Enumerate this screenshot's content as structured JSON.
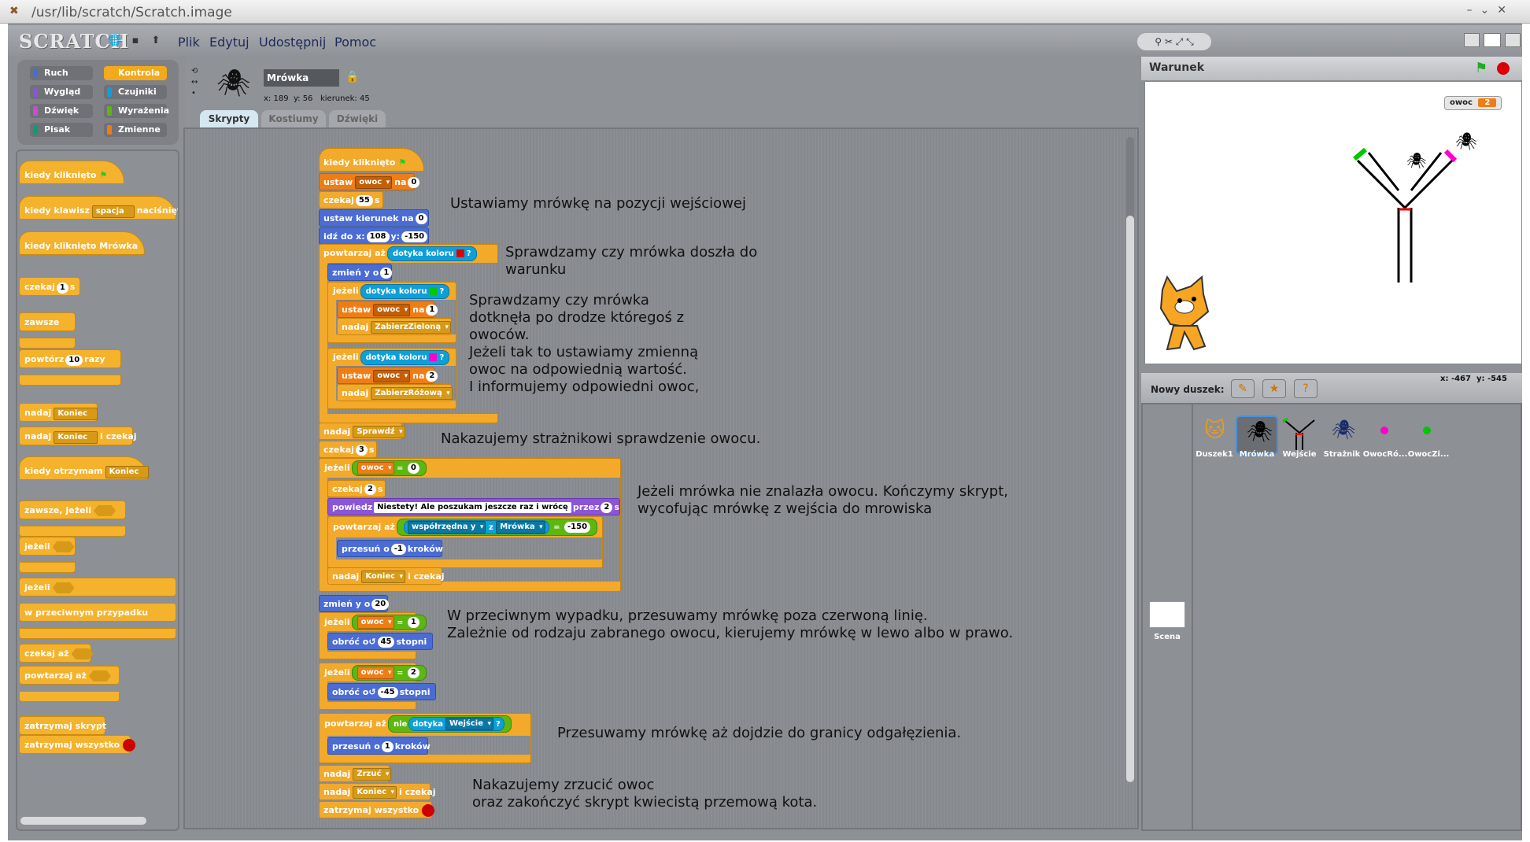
{
  "window": {
    "title": "/usr/lib/scratch/Scratch.image"
  },
  "menu": {
    "logo": "SCRATCH",
    "file": "Plik",
    "edit": "Edytuj",
    "share": "Udostępnij",
    "help": "Pomoc"
  },
  "categories": {
    "motion": "Ruch",
    "control": "Kontrola",
    "looks": "Wygląd",
    "sensing": "Czujniki",
    "sound": "Dźwięk",
    "operators": "Wyrażenia",
    "pen": "Pisak",
    "variables": "Zmienne"
  },
  "palette": {
    "when_flag": "kiedy kliknięto",
    "when_key": "kiedy klawisz",
    "key_value": "spacja",
    "key_pressed": "naciśnięty",
    "when_clicked": "kiedy kliknięto Mrówka",
    "wait": "czekaj",
    "wait_n": "1",
    "wait_unit": "s",
    "forever": "zawsze",
    "repeat": "powtórz",
    "repeat_n": "10",
    "repeat_unit": "razy",
    "broadcast": "nadaj",
    "broadcast_msg": "Koniec",
    "broadcast_wait": "i czekaj",
    "when_receive": "kiedy otrzymam",
    "forever_if": "zawsze, jeżeli",
    "if": "jeżeli",
    "else": "w przeciwnym przypadku",
    "wait_until": "czekaj aż",
    "repeat_until": "powtarzaj aż",
    "stop_script": "zatrzymaj skrypt",
    "stop_all": "zatrzymaj wszystko"
  },
  "sprite": {
    "name": "Mrówka",
    "x_label": "x:",
    "x": "189",
    "y_label": "y:",
    "y": "56",
    "dir_label": "kierunek:",
    "dir": "45"
  },
  "tabs": {
    "scripts": "Skrypty",
    "costumes": "Kostiumy",
    "sounds": "Dźwięki"
  },
  "script": {
    "b1": "kiedy kliknięto",
    "b2a": "ustaw",
    "b2v": "owoc",
    "b2b": "na",
    "b2n": "0",
    "b3a": "czekaj",
    "b3n": "55",
    "b3b": "s",
    "b4a": "ustaw kierunek na",
    "b4n": "0",
    "b5a": "idź do x:",
    "b5x": "108",
    "b5b": "y:",
    "b5y": "-150",
    "b6a": "powtarzaj aż",
    "b6s": "dotyka koloru",
    "b6q": "?",
    "b7a": "zmień y o",
    "b7n": "1",
    "b8a": "jeżeli",
    "b8s": "dotyka koloru",
    "b8q": "?",
    "b9a": "ustaw",
    "b9v": "owoc",
    "b9b": "na",
    "b9n": "1",
    "b10a": "nadaj",
    "b10m": "ZabierzZieloną",
    "b11a": "jeżeli",
    "b11s": "dotyka koloru",
    "b11q": "?",
    "b12a": "ustaw",
    "b12v": "owoc",
    "b12b": "na",
    "b12n": "2",
    "b13a": "nadaj",
    "b13m": "ZabierzRóżową",
    "b14a": "nadaj",
    "b14m": "Sprawdź",
    "b15a": "czekaj",
    "b15n": "3",
    "b15b": "s",
    "b16a": "jeżeli",
    "b16v": "owoc",
    "b16eq": "=",
    "b16n": "0",
    "b17a": "czekaj",
    "b17n": "2",
    "b17b": "s",
    "b18a": "powiedz",
    "b18t": "Niestety! Ale poszukam jeszcze raz i wrócę",
    "b18b": "przez",
    "b18n": "2",
    "b18c": "s",
    "b19a": "powtarzaj aż",
    "b19s": "współrzędna y",
    "b19z": "z",
    "b19sp": "Mrówka",
    "b19eq": "=",
    "b19n": "-150",
    "b20a": "przesuń o",
    "b20n": "-1",
    "b20b": "kroków",
    "b21a": "nadaj",
    "b21m": "Koniec",
    "b21b": "i czekaj",
    "b22a": "zmień y o",
    "b22n": "20",
    "b23a": "jeżeli",
    "b23v": "owoc",
    "b23eq": "=",
    "b23n": "1",
    "b24a": "obróć o",
    "b24r": "↺",
    "b24n": "45",
    "b24b": "stopni",
    "b25a": "jeżeli",
    "b25v": "owoc",
    "b25eq": "=",
    "b25n": "2",
    "b26a": "obróć o",
    "b26r": "↺",
    "b26n": "-45",
    "b26b": "stopni",
    "b27a": "powtarzaj aż",
    "b27not": "nie",
    "b27s": "dotyka",
    "b27m": "Wejście",
    "b27q": "?",
    "b28a": "przesuń o",
    "b28n": "1",
    "b28b": "kroków",
    "b29a": "nadaj",
    "b29m": "Zrzuć",
    "b30a": "nadaj",
    "b30m": "Koniec",
    "b30b": "i czekaj",
    "b31a": "zatrzymaj wszystko"
  },
  "comments": {
    "c1": "Ustawiamy mrówkę na pozycji wejściowej",
    "c2a": "Sprawdzamy czy mrówka doszła do",
    "c2b": "warunku",
    "c3a": "Sprawdzamy czy mrówka",
    "c3b": "dotknęła po drodze któregoś z",
    "c3c": "owoców.",
    "c3d": "Jeżeli tak to ustawiamy zmienną",
    "c3e": "owoc na odpowiednią wartość.",
    "c3f": "I informujemy odpowiedni owoc,",
    "c4": "Nakazujemy strażnikowi sprawdzenie owocu.",
    "c5a": "Jeżeli mrówka nie znalazła owocu. Kończymy skrypt,",
    "c5b": "wycofując mrówkę z wejścia do mrowiska",
    "c6a": "W przeciwnym wypadku, przesuwamy mrówkę poza czerwoną linię.",
    "c6b": "Zależnie od rodzaju zabranego owocu, kierujemy mrówkę w lewo albo w prawo.",
    "c7": "Przesuwamy mrówkę aż dojdzie do granicy odgałęzienia.",
    "c8a": "Nakazujemy zrzucić owoc",
    "c8b": "oraz zakończyć skrypt kwiecistą przemową kota."
  },
  "stage": {
    "title": "Warunek",
    "var_name": "owoc",
    "var_value": "2"
  },
  "sprites_panel": {
    "new_sprite": "Nowy duszek:",
    "mouse_x_label": "x:",
    "mouse_x": "-467",
    "mouse_y_label": "y:",
    "mouse_y": "-545",
    "sprites": [
      "Duszek1",
      "Mrówka",
      "Wejście",
      "Strażnik",
      "OwocRó...",
      "OwocZi..."
    ],
    "stage_label": "Scena"
  },
  "colors": {
    "control": "#f3a92a",
    "variables": "#ee7d16",
    "motion": "#4a6cd4",
    "sensing": "#0e9fd8",
    "looks": "#8a55d7",
    "operators": "#5cb712",
    "red": "#e00000",
    "green": "#00c800",
    "pink": "#ff00cc"
  }
}
